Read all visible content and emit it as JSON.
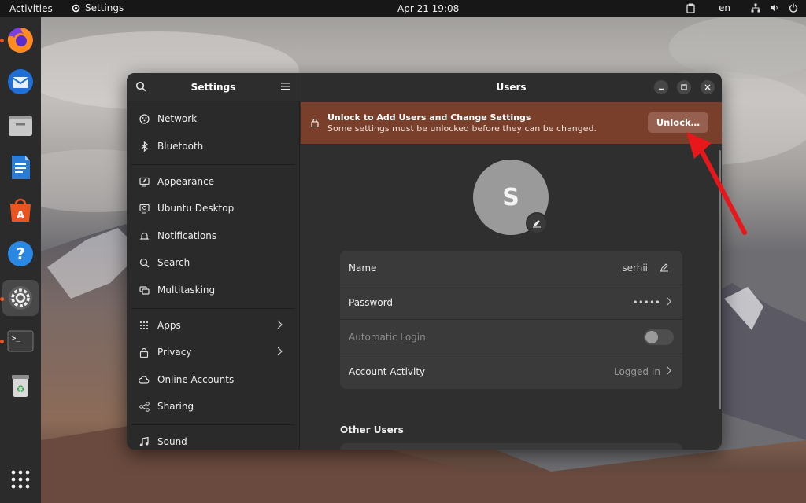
{
  "topbar": {
    "activities": "Activities",
    "app_name": "Settings",
    "clock": "Apr 21  19:08",
    "language": "en"
  },
  "dock": {
    "items": [
      {
        "name": "firefox",
        "running": true
      },
      {
        "name": "thunderbird",
        "running": false
      },
      {
        "name": "files",
        "running": false
      },
      {
        "name": "libreoffice-writer",
        "running": false
      },
      {
        "name": "ubuntu-software",
        "running": false
      },
      {
        "name": "help",
        "running": false
      },
      {
        "name": "settings",
        "running": true,
        "active": true
      },
      {
        "name": "terminal",
        "running": true
      },
      {
        "name": "trash",
        "running": false
      }
    ]
  },
  "sidebar": {
    "title": "Settings",
    "items": [
      {
        "label": "Network",
        "icon": "network-icon"
      },
      {
        "label": "Bluetooth",
        "icon": "bluetooth-icon"
      },
      {
        "label": "Appearance",
        "icon": "appearance-icon"
      },
      {
        "label": "Ubuntu Desktop",
        "icon": "ubuntu-desktop-icon"
      },
      {
        "label": "Notifications",
        "icon": "bell-icon"
      },
      {
        "label": "Search",
        "icon": "search-icon"
      },
      {
        "label": "Multitasking",
        "icon": "multitasking-icon"
      },
      {
        "label": "Apps",
        "icon": "apps-icon",
        "chevron": true
      },
      {
        "label": "Privacy",
        "icon": "lock-icon",
        "chevron": true
      },
      {
        "label": "Online Accounts",
        "icon": "cloud-icon"
      },
      {
        "label": "Sharing",
        "icon": "share-icon"
      },
      {
        "label": "Sound",
        "icon": "music-note-icon"
      }
    ]
  },
  "main": {
    "title": "Users",
    "infobar": {
      "heading": "Unlock to Add Users and Change Settings",
      "subtext": "Some settings must be unlocked before they can be changed.",
      "button": "Unlock…"
    },
    "avatar_initial": "S",
    "details": {
      "name_label": "Name",
      "name_value": "serhii",
      "password_label": "Password",
      "password_value": "•••••",
      "autologin_label": "Automatic Login",
      "autologin_enabled": false,
      "activity_label": "Account Activity",
      "activity_value": "Logged In"
    },
    "other_users_heading": "Other Users"
  },
  "colors": {
    "infobar": "#7a3f2b",
    "accent": "#e95420",
    "annotation_arrow": "#e8171b"
  }
}
